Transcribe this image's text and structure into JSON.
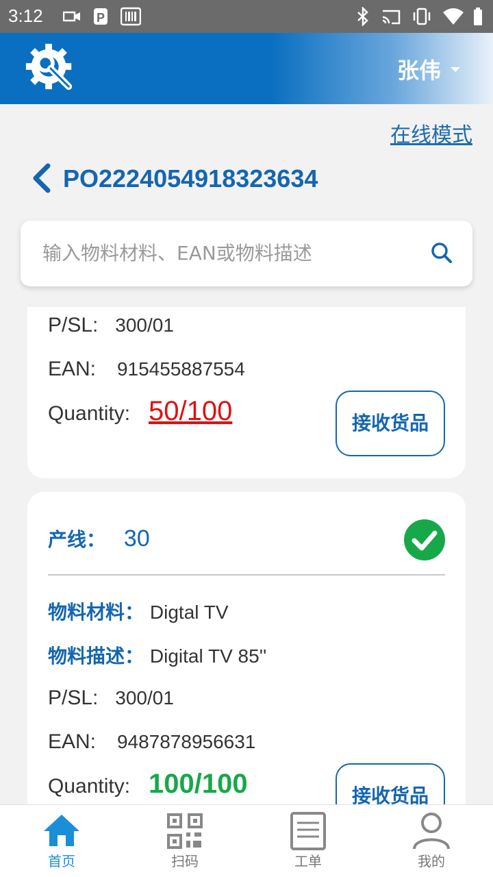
{
  "status_bar": {
    "time": "3:12"
  },
  "header": {
    "user_name": "张伟"
  },
  "mode_link": "在线模式",
  "po_number": "PO2224054918323634",
  "search": {
    "placeholder": "输入物料材料、EAN或物料描述"
  },
  "cards": [
    {
      "psl_label": "P/SL:",
      "psl_value": "300/01",
      "ean_label": "EAN:",
      "ean_value": "915455887554",
      "qty_label": "Quantity:",
      "qty_value": "50/100",
      "button_label": "接收货品"
    },
    {
      "line_label": "产线：",
      "line_value": "30",
      "material_label": "物料材料：",
      "material_value": "Digtal TV",
      "desc_label": "物料描述：",
      "desc_value": "Digital TV 85''",
      "psl_label": "P/SL:",
      "psl_value": "300/01",
      "ean_label": "EAN:",
      "ean_value": "9487878956631",
      "qty_label": "Quantity:",
      "qty_value": "100/100",
      "button_label": "接收货品"
    }
  ],
  "bottom_nav": [
    {
      "label": "首页",
      "icon": "home-icon",
      "active": true
    },
    {
      "label": "扫码",
      "icon": "qr-code-icon",
      "active": false
    },
    {
      "label": "工单",
      "icon": "document-icon",
      "active": false
    },
    {
      "label": "我的",
      "icon": "person-icon",
      "active": false
    }
  ],
  "colors": {
    "primary": "#1466b0",
    "danger": "#e01010",
    "success": "#17a84a",
    "status_bar": "#6b6b6b"
  }
}
